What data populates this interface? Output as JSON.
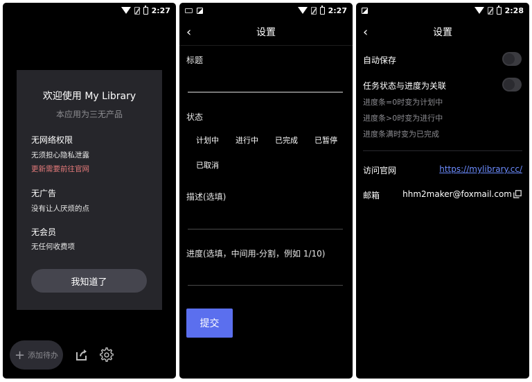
{
  "status_bar": {
    "time_1": "2:27",
    "time_2": "2:27",
    "time_3": "2:28"
  },
  "welcome": {
    "title": "欢迎使用 My Library",
    "subtitle": "本应用为三无产品",
    "features": [
      {
        "heading": "无网络权限",
        "line1": "无须担心隐私泄露",
        "line2": "更新需要前往官网"
      },
      {
        "heading": "无广告",
        "line1": "没有让人厌烦的点"
      },
      {
        "heading": "无会员",
        "line1": "无任何收费项"
      }
    ],
    "ok_button": "我知道了"
  },
  "bottom_bar": {
    "add_label": "添加待办",
    "icons": [
      "plus-icon",
      "share-icon",
      "gear-icon"
    ]
  },
  "form": {
    "page_title": "设置",
    "title_label": "标题",
    "status_label": "状态",
    "status_options": [
      "计划中",
      "进行中",
      "已完成",
      "已暂停",
      "已取消"
    ],
    "desc_label": "描述(选填)",
    "progress_label": "进度(选填，中间用-分割，例如 1/10)",
    "submit": "提交"
  },
  "settings": {
    "page_title": "设置",
    "auto_save": "自动保存",
    "link_progress": "任务状态与进度为关联",
    "rules": [
      "进度条=0时变为计划中",
      "进度条>0时变为进行中",
      "进度条满时变为已完成"
    ],
    "website_label": "访问官网",
    "website_url": "https://mylibrary.cc/",
    "email_label": "邮箱",
    "email_value": "hhm2maker@foxmail.com"
  },
  "colors": {
    "accent": "#5b6fee",
    "warning_text": "#e47a7a",
    "link": "#6c8cff",
    "dialog_bg": "#26262b"
  }
}
